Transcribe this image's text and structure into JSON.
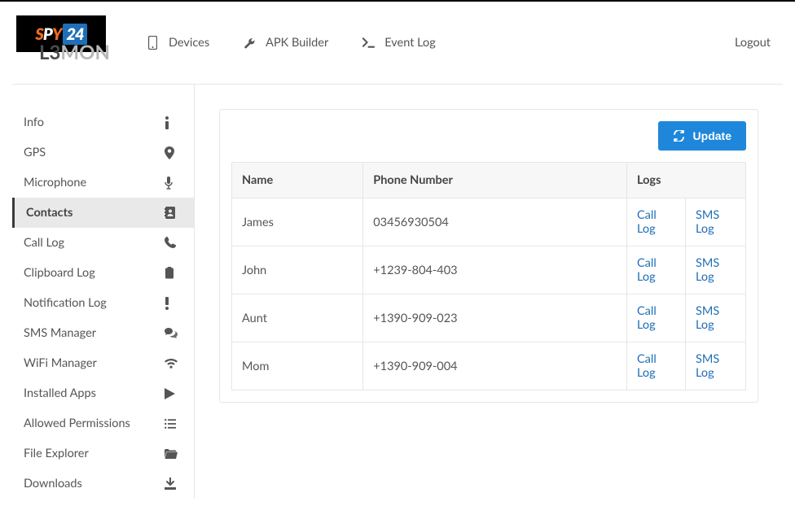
{
  "logo_badge": {
    "s": "S",
    "p": "P",
    "y": "Y",
    "n24": "24"
  },
  "brand": {
    "l3": "L3",
    "mon": "MON"
  },
  "nav": {
    "devices": "Devices",
    "apk": "APK Builder",
    "event": "Event Log"
  },
  "logout": "Logout",
  "sidebar": {
    "items": [
      {
        "label": "Info"
      },
      {
        "label": "GPS"
      },
      {
        "label": "Microphone"
      },
      {
        "label": "Contacts"
      },
      {
        "label": "Call Log"
      },
      {
        "label": "Clipboard Log"
      },
      {
        "label": "Notification Log"
      },
      {
        "label": "SMS Manager"
      },
      {
        "label": "WiFi Manager"
      },
      {
        "label": "Installed Apps"
      },
      {
        "label": "Allowed Permissions"
      },
      {
        "label": "File Explorer"
      },
      {
        "label": "Downloads"
      }
    ],
    "active_index": 3
  },
  "update_button": "Update",
  "table": {
    "headers": {
      "name": "Name",
      "phone": "Phone Number",
      "logs": "Logs"
    },
    "link_labels": {
      "call": "Call Log",
      "sms": "SMS Log"
    },
    "rows": [
      {
        "name": "James",
        "phone": "03456930504"
      },
      {
        "name": "John",
        "phone": "+1239-804-403"
      },
      {
        "name": "Aunt",
        "phone": "+1390-909-023"
      },
      {
        "name": "Mom",
        "phone": "+1390-909-004"
      }
    ]
  }
}
